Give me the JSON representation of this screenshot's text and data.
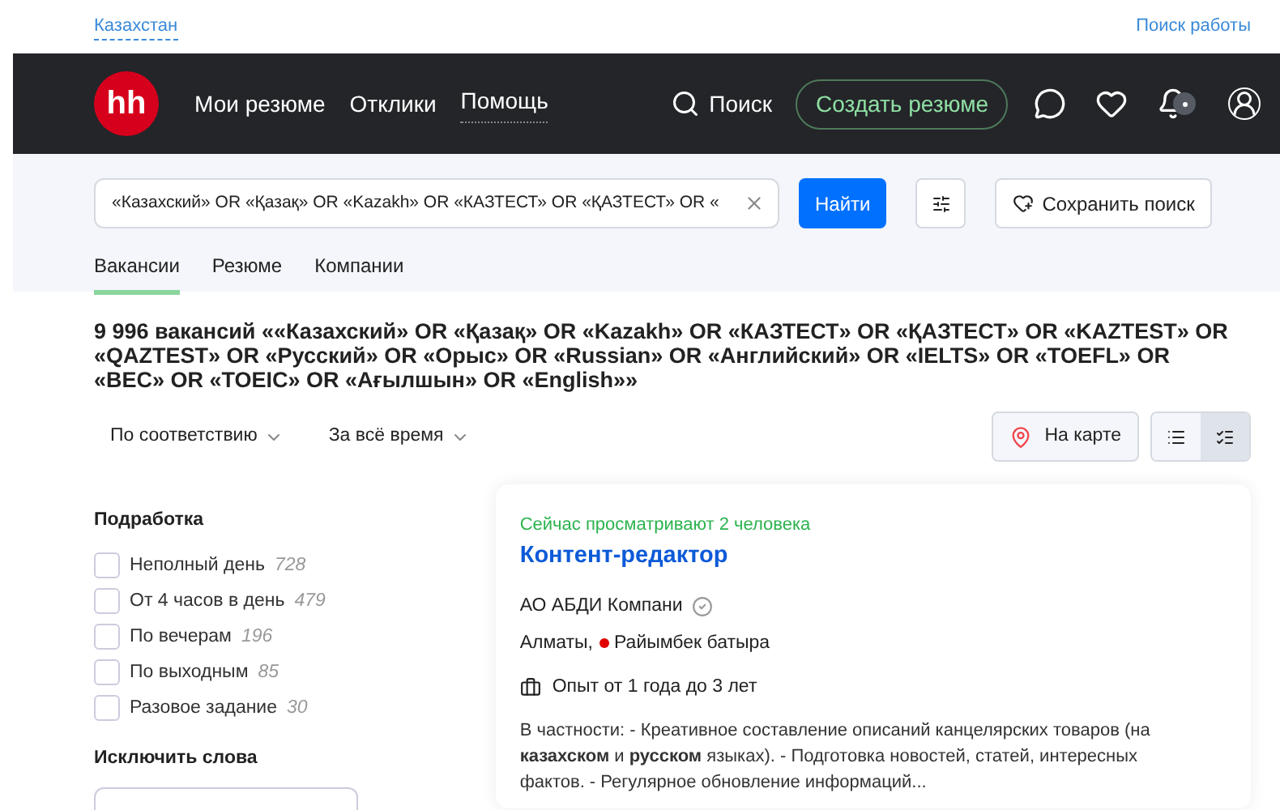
{
  "top_bar": {
    "region": "Казахстан",
    "job_search": "Поиск работы"
  },
  "nav": {
    "logo": "hh",
    "links": [
      {
        "label": "Мои резюме",
        "dotted": false
      },
      {
        "label": "Отклики",
        "dotted": false
      },
      {
        "label": "Помощь",
        "dotted": true
      }
    ],
    "search": "Поиск",
    "create": "Создать резюме",
    "notification_badge": true
  },
  "search": {
    "value": "«Казахский» OR «Қазақ» OR «Kazakh» OR «КАЗТЕСТ» OR «ҚАЗТЕСТ» OR «",
    "submit": "Найти",
    "save": "Сохранить поиск"
  },
  "tabs": [
    {
      "label": "Вакансии",
      "selected": true
    },
    {
      "label": "Резюме",
      "selected": false
    },
    {
      "label": "Компании",
      "selected": false
    }
  ],
  "results_title": "9 996 вакансий ««Казахский» OR «Қазақ» OR «Kazakh» OR «КАЗТЕСТ» OR «ҚАЗТЕСТ» OR «KAZTEST» OR «QAZTEST» OR «Русский» OR «Орыс» OR «Russian» OR «Английский» OR «IELTS» OR «TOEFL» OR «BEC» OR «TOEIC» OR «Ағылшын» OR «English»»",
  "sort": [
    "По соответствию",
    "За всё время"
  ],
  "map_button": "На карте",
  "view_modes": [
    {
      "kind": "compact",
      "selected": false
    },
    {
      "kind": "detailed",
      "selected": true
    }
  ],
  "filters": {
    "title": "Подработка",
    "items": [
      {
        "label": "Неполный день",
        "count": "728",
        "checked": false
      },
      {
        "label": "От 4 часов в день",
        "count": "479",
        "checked": false
      },
      {
        "label": "По вечерам",
        "count": "196",
        "checked": false
      },
      {
        "label": "По выходным",
        "count": "85",
        "checked": false
      },
      {
        "label": "Разовое задание",
        "count": "30",
        "checked": false
      }
    ],
    "exclude_title": "Исключить слова"
  },
  "vacancy": {
    "viewers": "Сейчас просматривают 2 человека",
    "title": "Контент-редактор",
    "company": "АО АБДИ Компани",
    "verified": true,
    "city": "Алматы,",
    "metro": "Райымбек батыра",
    "experience": "Опыт от 1 года до 3 лет",
    "description": "В частности: - Креативное составление описаний канцелярских товаров (на **казахском** и **русском** языках). - Подготовка новостей, статей, интересных фактов. - Регулярное обновление информаций..."
  }
}
